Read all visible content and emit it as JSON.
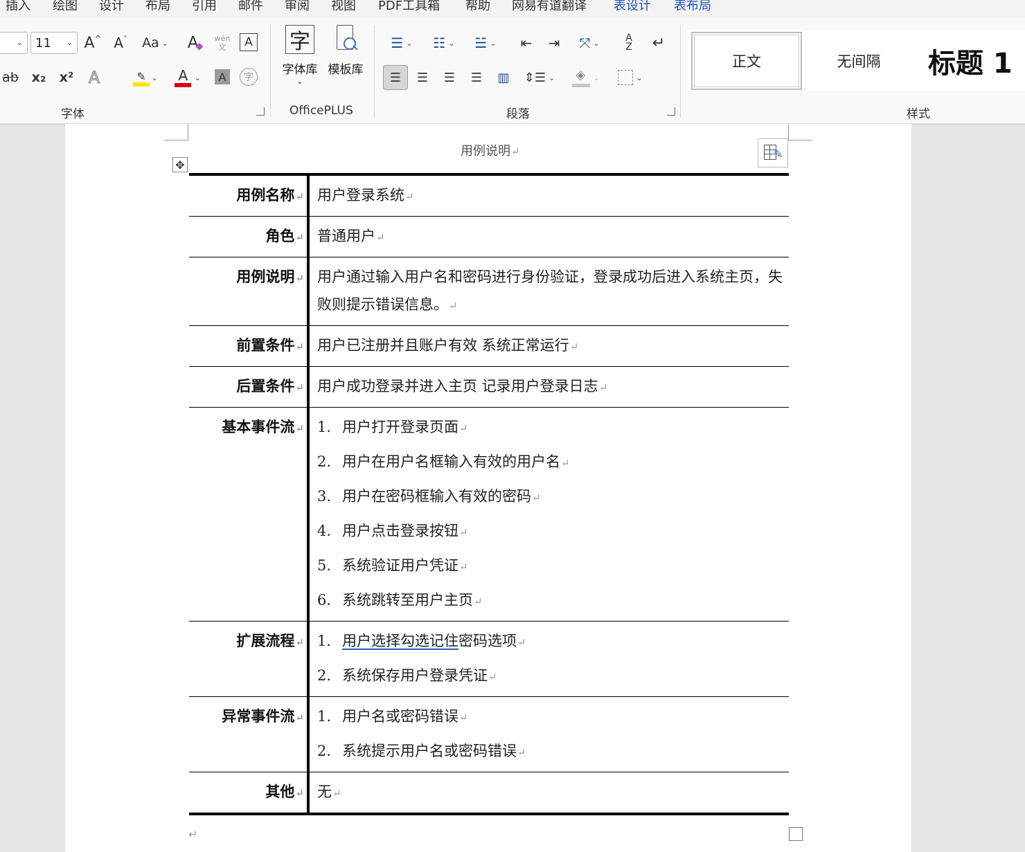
{
  "menu": [
    "插入",
    "绘图",
    "设计",
    "布局",
    "引用",
    "邮件",
    "审阅",
    "视图",
    "PDF工具箱",
    "帮助",
    "网易有道翻译",
    "表设计",
    "表布局"
  ],
  "ribbon": {
    "font_size": "11",
    "groups": {
      "font": "字体",
      "officeplus": "OfficePLUS",
      "paragraph": "段落",
      "styles": "样式"
    },
    "buttons": {
      "grow_font": "A^",
      "shrink_font": "Aˇ",
      "change_case": "Aa",
      "font_library": "字体库",
      "template_library": "模板库",
      "phonetic_top": "wén",
      "phonetic_bottom": "文",
      "strikethrough": "ab",
      "subscript": "x₂",
      "superscript": "x²",
      "font_color": "A",
      "char_shading": "A",
      "enclosed_char": "字",
      "text_effect": "A",
      "border_char": "A"
    },
    "styles": [
      "正文",
      "无间隔",
      "标题 1"
    ]
  },
  "document": {
    "header": "用例说明",
    "table": [
      {
        "label": "用例名称",
        "value": "用户登录系统"
      },
      {
        "label": "角色",
        "value": "普通用户"
      },
      {
        "label": "用例说明",
        "value": "用户通过输入用户名和密码进行身份验证，登录成功后进入系统主页，失败则提示错误信息。"
      },
      {
        "label": "前置条件",
        "value": "用户已注册并且账户有效 系统正常运行"
      },
      {
        "label": "后置条件",
        "value": "用户成功登录并进入主页 记录用户登录日志"
      },
      {
        "label": "基本事件流",
        "items": [
          "用户打开登录页面",
          "用户在用户名框输入有效的用户名",
          "用户在密码框输入有效的密码",
          "用户点击登录按钮",
          "系统验证用户凭证",
          "系统跳转至用户主页"
        ]
      },
      {
        "label": "扩展流程",
        "items_underlined_prefix": "用户选择勾选记住",
        "items": [
          "密码选项",
          "系统保存用户登录凭证"
        ]
      },
      {
        "label": "异常事件流",
        "items": [
          "用户名或密码错误",
          "系统提示用户名或密码错误"
        ]
      },
      {
        "label": "其他",
        "value": "无"
      }
    ]
  },
  "colors": {
    "accent_blue": "#1d55b3",
    "highlight_yellow": "#ffe600",
    "font_red": "#e00000"
  }
}
